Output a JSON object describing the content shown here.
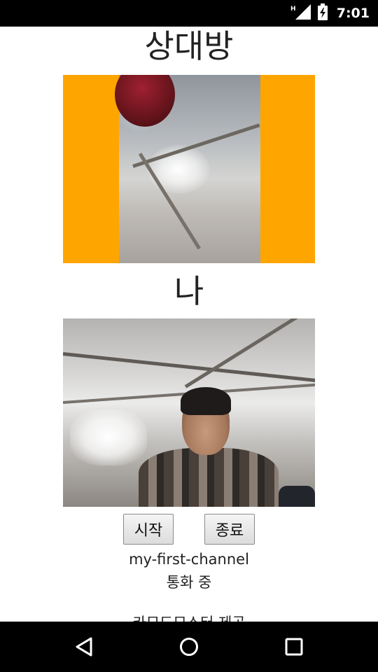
{
  "status_bar": {
    "time": "7:01",
    "network_label": "H",
    "icons": [
      "network-h-icon",
      "signal-icon",
      "battery-charging-icon"
    ]
  },
  "remote": {
    "title": "상대방",
    "frame_color": "#ffa500"
  },
  "local": {
    "title": "나"
  },
  "controls": {
    "start_label": "시작",
    "end_label": "종료"
  },
  "channel": {
    "name": "my-first-channel",
    "status": "통화 중"
  },
  "footer": {
    "partial_text": "카모드모스터 제공"
  },
  "nav_bar": {
    "icons": [
      "back-icon",
      "home-icon",
      "recents-icon"
    ]
  }
}
